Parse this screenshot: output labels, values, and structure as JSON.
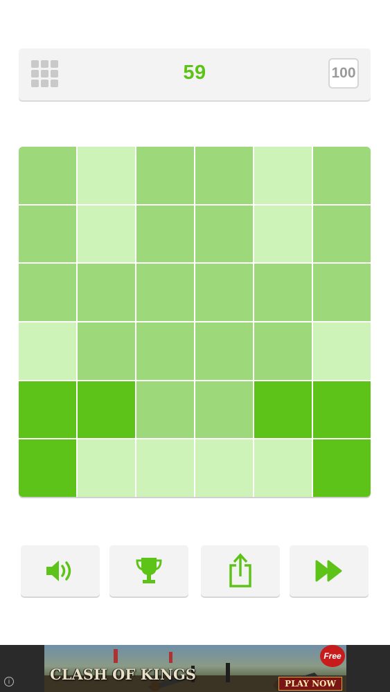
{
  "header": {
    "level": "59",
    "target": "100",
    "menu_icon": "grid-menu-icon"
  },
  "colors": {
    "accent": "#5ec318",
    "dark": "#5ec318",
    "medium": "#9dd97a",
    "light": "#cdf3b8"
  },
  "board": {
    "rows": 6,
    "cols": 6,
    "tiles": [
      [
        "medium",
        "light",
        "medium",
        "medium",
        "light",
        "medium"
      ],
      [
        "medium",
        "light",
        "medium",
        "medium",
        "light",
        "medium"
      ],
      [
        "medium",
        "medium",
        "medium",
        "medium",
        "medium",
        "medium"
      ],
      [
        "light",
        "medium",
        "medium",
        "medium",
        "medium",
        "light"
      ],
      [
        "dark",
        "dark",
        "medium",
        "medium",
        "dark",
        "dark"
      ],
      [
        "dark",
        "light",
        "light",
        "light",
        "light",
        "dark"
      ]
    ]
  },
  "buttons": [
    {
      "name": "sound-button",
      "icon": "speaker-icon"
    },
    {
      "name": "leaderboard-button",
      "icon": "trophy-icon"
    },
    {
      "name": "share-button",
      "icon": "share-icon"
    },
    {
      "name": "skip-button",
      "icon": "fast-forward-icon"
    }
  ],
  "ad": {
    "title": "CLASH OF KINGS",
    "badge": "Free",
    "cta": "PLAY NOW",
    "info_icon": "info-icon"
  }
}
